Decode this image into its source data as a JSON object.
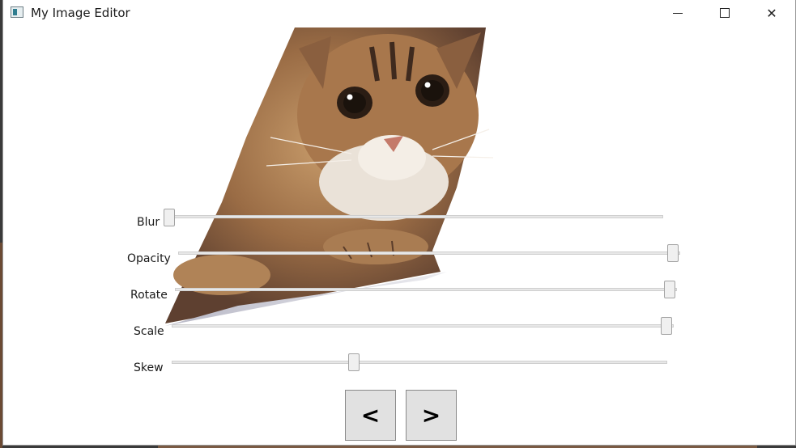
{
  "window": {
    "title": "My Image Editor",
    "icons": {
      "app": "app-image-icon",
      "minimize": "minimize-icon",
      "maximize": "maximize-icon",
      "close": "close-icon"
    },
    "close_glyph": "✕"
  },
  "image": {
    "subject": "tabby-kitten-photo"
  },
  "sliders": [
    {
      "label": "Blur",
      "value": 0.0
    },
    {
      "label": "Opacity",
      "value": 1.0
    },
    {
      "label": "Rotate",
      "value": 1.0
    },
    {
      "label": "Scale",
      "value": 1.0
    },
    {
      "label": "Skew",
      "value": 0.37
    }
  ],
  "buttons": {
    "prev_label": "<",
    "next_label": ">"
  }
}
